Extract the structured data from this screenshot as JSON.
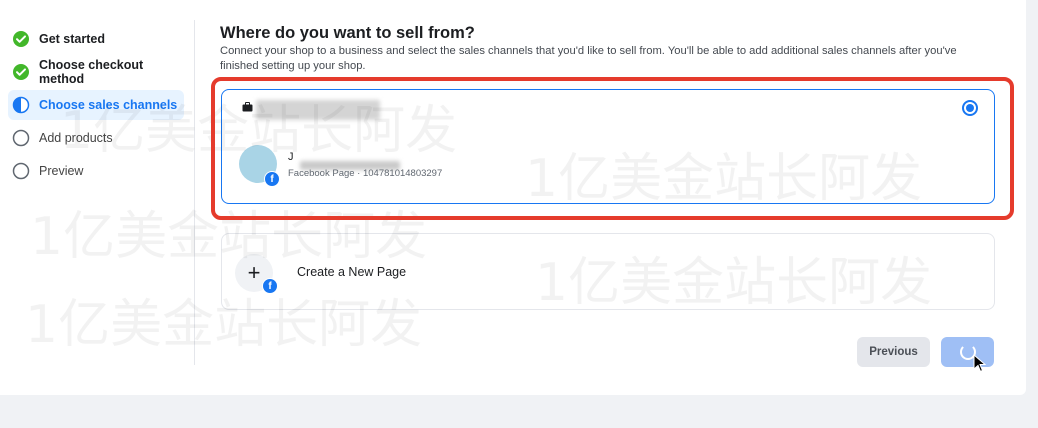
{
  "steps": [
    {
      "label": "Get started",
      "state": "done"
    },
    {
      "label": "Choose checkout method",
      "state": "done"
    },
    {
      "label": "Choose sales channels",
      "state": "active"
    },
    {
      "label": "Add products",
      "state": "pending"
    },
    {
      "label": "Preview",
      "state": "pending"
    }
  ],
  "heading": "Where do you want to sell from?",
  "description": "Connect your shop to a business and select the sales channels that you'd like to sell from. You'll be able to add additional sales channels after you've finished setting up your shop.",
  "selected_option": {
    "business_icon": "briefcase-icon",
    "page_name": "J",
    "page_meta": "Facebook Page · 104781014803297",
    "selected": true
  },
  "create_page": {
    "label": "Create a New Page",
    "icon": "plus-icon"
  },
  "buttons": {
    "previous": "Previous",
    "next_state": "loading"
  },
  "watermark": "1亿美金站长阿发",
  "colors": {
    "accent": "#1877f2",
    "highlight_frame": "#e53b2c",
    "done_check": "#42b72a"
  }
}
